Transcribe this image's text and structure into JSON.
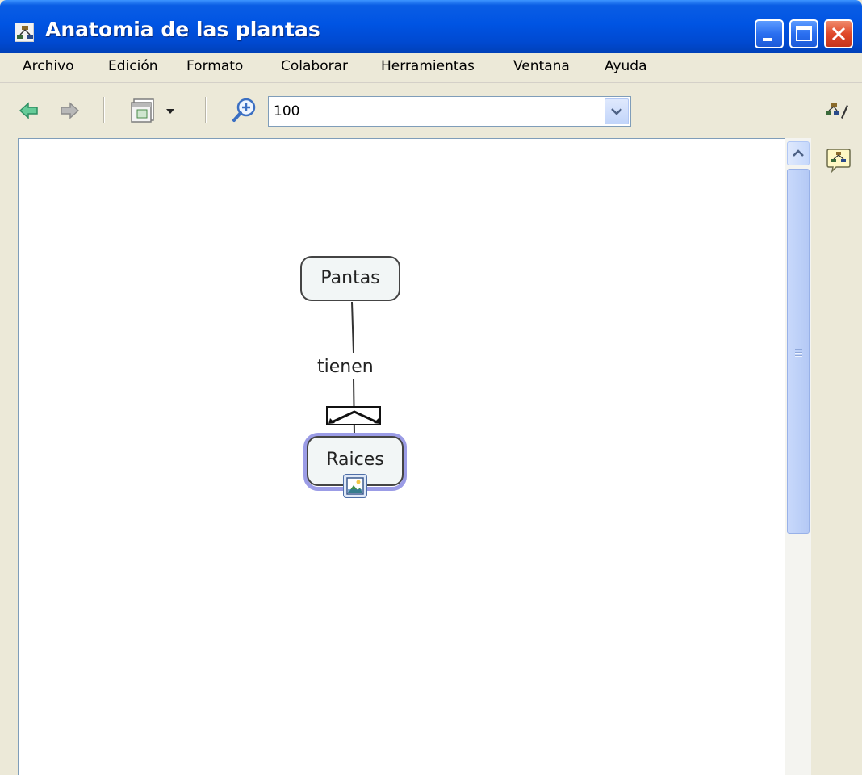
{
  "window": {
    "title": "Anatomia de las plantas",
    "controls": [
      "minimize",
      "maximize",
      "close"
    ]
  },
  "menu": {
    "items": [
      "Archivo",
      "Edición",
      "Formato",
      "Colaborar",
      "Herramientas",
      "Ventana",
      "Ayuda"
    ]
  },
  "toolbar": {
    "back_icon": "arrow-left-icon",
    "forward_icon": "arrow-right-icon",
    "view_icon": "view-mode-icon",
    "zoom_icon": "zoom-in-icon",
    "zoom_value": "100",
    "side_icons": [
      "styles-icon",
      "concept-map-icon"
    ]
  },
  "map": {
    "concepts": [
      {
        "id": "pantas",
        "label": "Pantas"
      },
      {
        "id": "raices",
        "label": "Raices",
        "selected": true,
        "has_image_resource": true
      }
    ],
    "links": [
      {
        "from": "pantas",
        "to": "raices",
        "label": "tienen"
      }
    ]
  },
  "colors": {
    "title_bar": "#0054e3",
    "menu_background": "#ece9d8",
    "concept_fill": "#f2f6f6",
    "selection_outline": "#9b9ce6",
    "close_button": "#e0492a"
  }
}
